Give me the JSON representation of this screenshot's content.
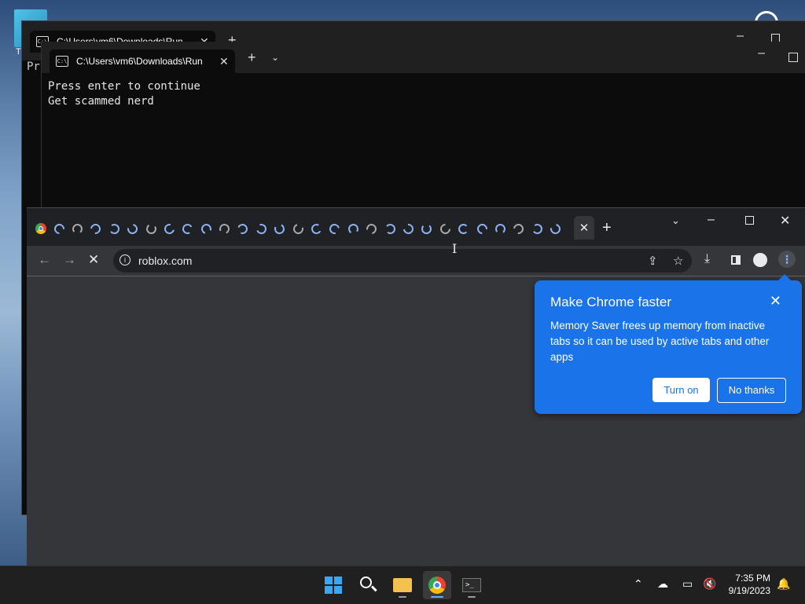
{
  "desktop": {
    "icon_label": "T"
  },
  "terminal_back": {
    "tab_title": "C:\\Users\\vm6\\Downloads\\Run",
    "prompt_text": "Pr"
  },
  "terminal_front": {
    "tab_title": "C:\\Users\\vm6\\Downloads\\Run",
    "output_lines": [
      "Press enter to continue",
      "Get scammed nerd"
    ]
  },
  "chrome": {
    "url": "roblox.com",
    "tab_count": 29,
    "popup": {
      "title": "Make Chrome faster",
      "body": "Memory Saver frees up memory from inactive tabs so it can be used by active tabs and other apps",
      "turn_on": "Turn on",
      "no_thanks": "No thanks"
    },
    "accent": "#1a73e8"
  },
  "taskbar": {
    "time": "7:35 PM",
    "date": "9/19/2023"
  }
}
